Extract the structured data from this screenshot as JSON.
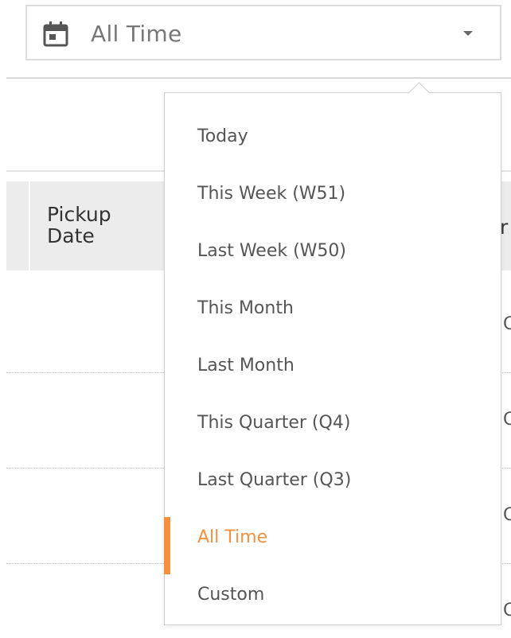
{
  "date_filter": {
    "selected_value": "All Time",
    "calendar_icon": "calendar-icon",
    "dropdown_icon": "caret-down-icon"
  },
  "table": {
    "headers": {
      "pickup_date": "Pickup Date"
    }
  },
  "dropdown": {
    "options": [
      {
        "label": "Today"
      },
      {
        "label": "This Week (W51)"
      },
      {
        "label": "Last Week (W50)"
      },
      {
        "label": "This Month"
      },
      {
        "label": "Last Month"
      },
      {
        "label": "This Quarter (Q4)"
      },
      {
        "label": "Last Quarter (Q3)"
      },
      {
        "label": "All Time",
        "selected": true
      },
      {
        "label": "Custom"
      }
    ]
  },
  "colors": {
    "accent": "#f7913d",
    "header_bg": "#ececec",
    "border": "#dcdcdc"
  }
}
